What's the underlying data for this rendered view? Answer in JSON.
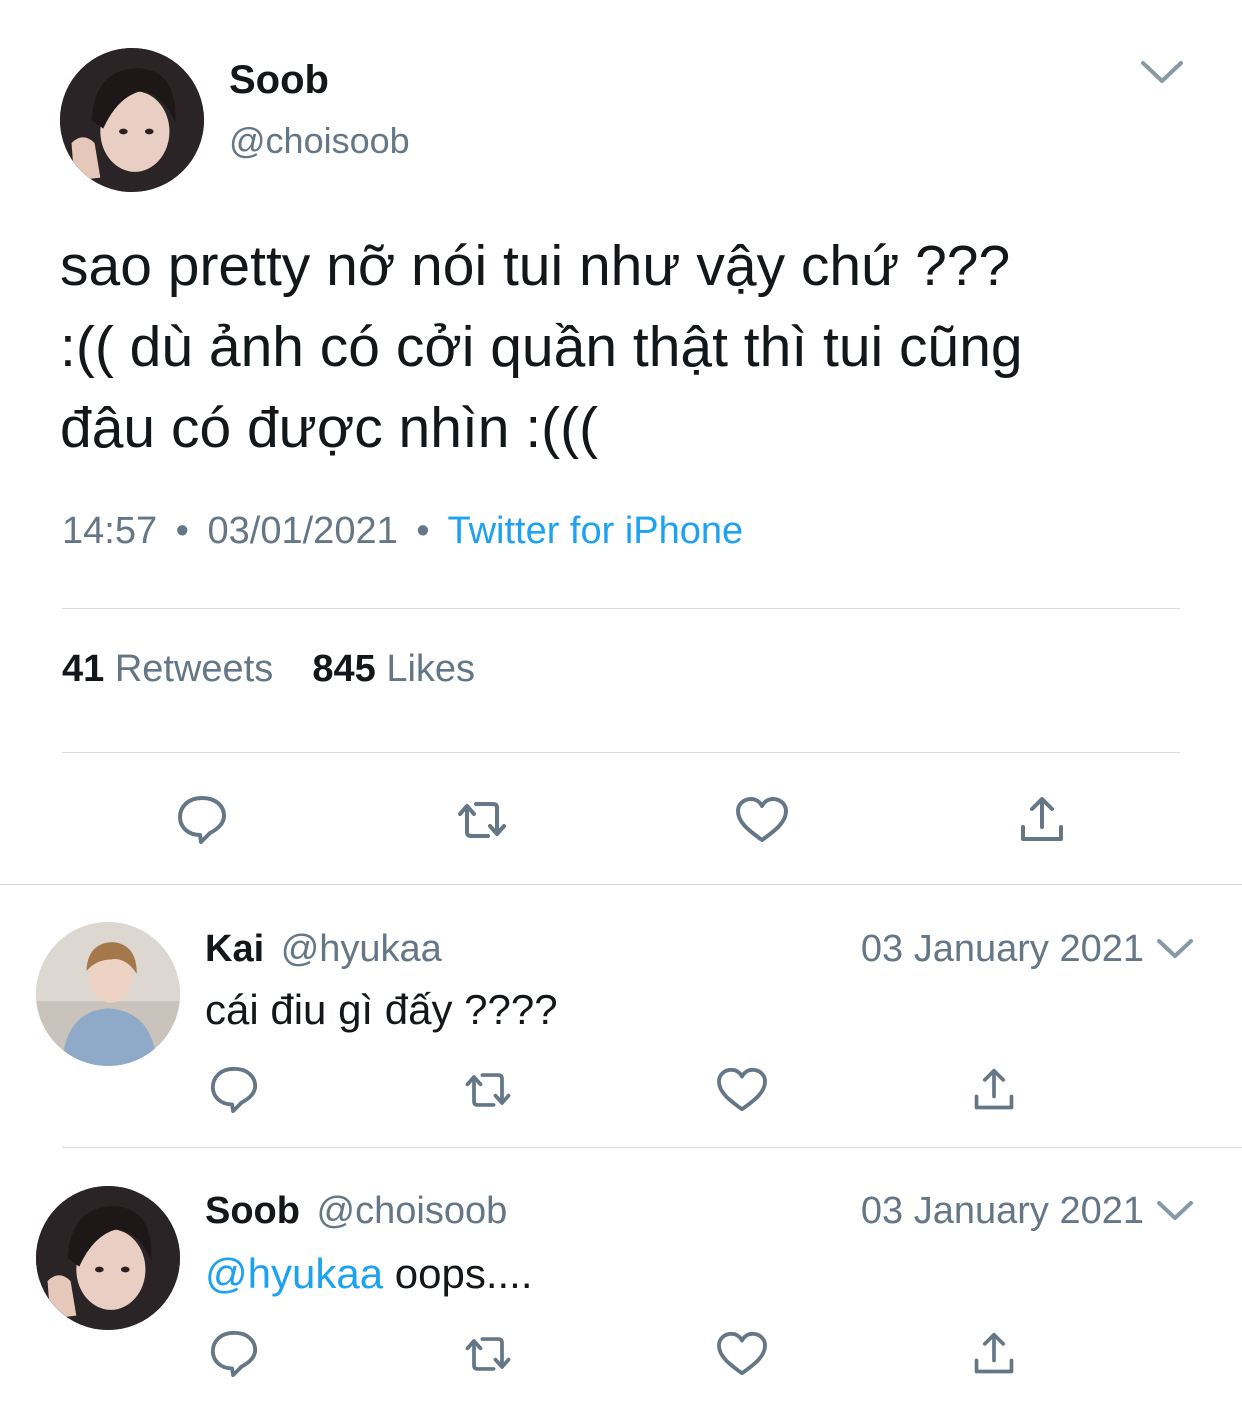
{
  "main_tweet": {
    "author_name": "Soob",
    "handle": "@choisoob",
    "avatar": "avatar-photo",
    "text": "sao pretty nỡ nói tui như vậy chứ ???\n:(( dù ảnh có cởi quần thật thì tui cũng\nđâu có được nhìn :(((",
    "time": "14:57",
    "separator": "•",
    "date": "03/01/2021",
    "source": "Twitter for iPhone",
    "retweet_count": "41",
    "retweet_label": "Retweets",
    "like_count": "845",
    "like_label": "Likes",
    "menu_icon": "chevron-down-icon",
    "actions": [
      "reply-icon",
      "retweet-icon",
      "like-icon",
      "share-icon"
    ]
  },
  "replies": [
    {
      "author_name": "Kai",
      "handle": "@hyukaa",
      "date": "03 January 2021",
      "mention": "",
      "text": "cái điu gì đấy ????",
      "avatar": "avatar-photo"
    },
    {
      "author_name": "Soob",
      "handle": "@choisoob",
      "date": "03 January 2021",
      "mention": "@hyukaa",
      "text": " oops....",
      "avatar": "avatar-photo"
    }
  ],
  "colors": {
    "text": "#14171a",
    "secondary": "#657786",
    "link": "#1da1f2",
    "icon": "#657786",
    "divider": "#d8dde1"
  }
}
